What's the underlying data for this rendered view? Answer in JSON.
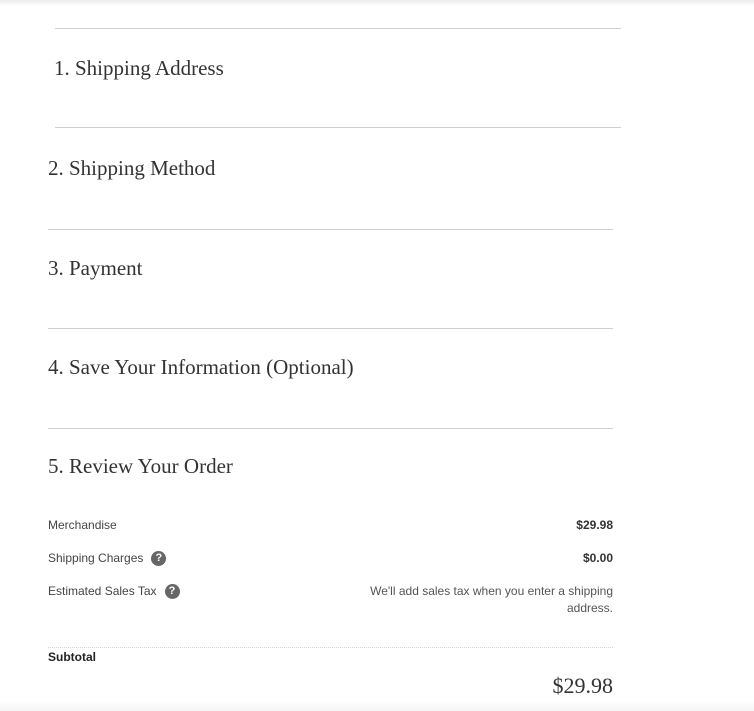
{
  "steps": [
    {
      "label": "1. Shipping Address"
    },
    {
      "label": "2. Shipping Method"
    },
    {
      "label": "3. Payment"
    },
    {
      "label": "4. Save Your Information (Optional)"
    },
    {
      "label": "5. Review Your Order"
    }
  ],
  "review": {
    "merchandise_label": "Merchandise",
    "merchandise_value": "$29.98",
    "shipping_label": "Shipping Charges",
    "shipping_value": "$0.00",
    "tax_label": "Estimated Sales Tax",
    "tax_note": "We'll add sales tax when you enter a shipping address.",
    "subtotal_label": "Subtotal",
    "subtotal_value": "$29.98"
  },
  "icons": {
    "help": "question-circle-icon",
    "help_glyph": "?"
  },
  "colors": {
    "text": "#333333",
    "rule": "#cfcfcf",
    "help_icon_bg": "#666666"
  }
}
